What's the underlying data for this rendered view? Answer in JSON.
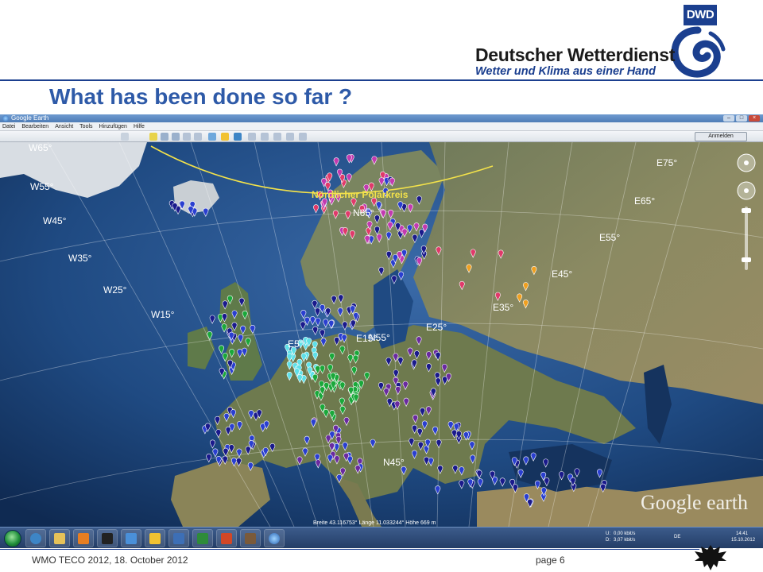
{
  "slide": {
    "title": "What has been done so far ?",
    "footer_left": "WMO TECO 2012, 18. October 2012",
    "footer_page": "page 6"
  },
  "brand": {
    "logo_text": "DWD",
    "name": "Deutscher Wetterdienst",
    "tagline": "Wetter und Klima aus einer Hand",
    "primary_color": "#1b3f8f",
    "title_color": "#2e5aa8"
  },
  "google_earth": {
    "window_title": "Google Earth",
    "menu": [
      "Datei",
      "Bearbeiten",
      "Ansicht",
      "Tools",
      "Hinzufügen",
      "Hilfe"
    ],
    "signin_label": "Anmelden",
    "watermark": "Google earth",
    "arctic_circle_label": "Nördlicher Polarkreis",
    "longitude_labels": [
      "W65°",
      "W55°",
      "W45°",
      "W35°",
      "W25°",
      "W15°",
      "E5°",
      "E15°",
      "E25°",
      "E35°",
      "E45°",
      "E55°",
      "E65°",
      "E75°"
    ],
    "latitude_labels": [
      "N65°",
      "N55°",
      "N45°"
    ],
    "status_bar": "Breite  43.116753°  Länge  11.033244°  Höhe  669 m",
    "marker_colors": {
      "blue": "#2a3fd0",
      "dark_blue": "#1a1a8c",
      "red": "#e03a6a",
      "magenta": "#c23ab0",
      "green": "#1aa83a",
      "cyan": "#5fe0e8",
      "purple": "#6a2aa0",
      "orange": "#f0a020"
    }
  },
  "taskbar": {
    "lang": "DE",
    "network_up": "0,00 kbit/s",
    "network_down": "3,07 kbit/s",
    "time": "14:41",
    "date": "15.10.2012",
    "net_u_label": "U:",
    "net_d_label": "D:"
  }
}
